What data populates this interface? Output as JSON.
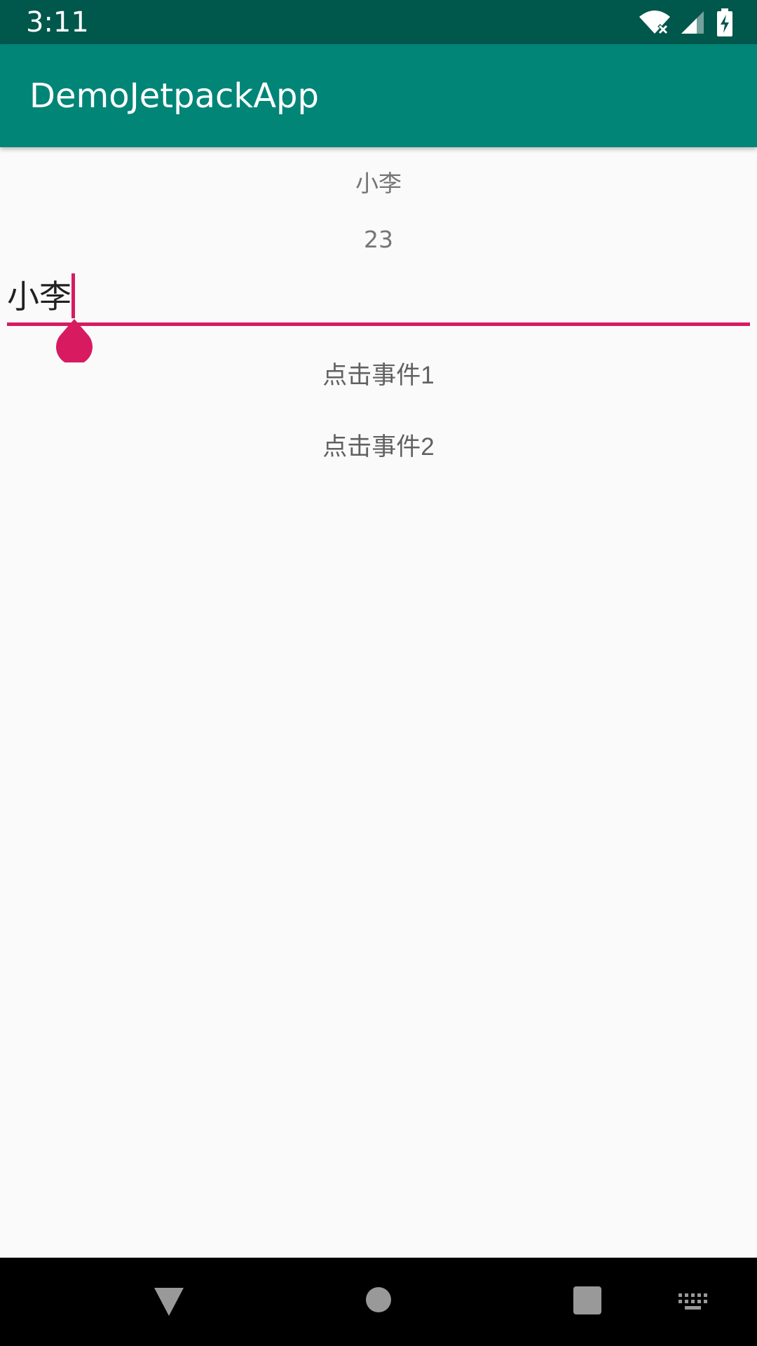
{
  "status_bar": {
    "time": "3:11",
    "icons": [
      "wifi-icon",
      "signal-icon",
      "battery-charging-icon"
    ]
  },
  "app_bar": {
    "title": "DemoJetpackApp"
  },
  "content": {
    "name_text": "小李",
    "age_text": "23",
    "name_input_value": "小李",
    "button_1_label": "点击事件1",
    "button_2_label": "点击事件2"
  },
  "nav_bar": {
    "icons": [
      "back-icon",
      "home-icon",
      "recents-icon",
      "keyboard-icon"
    ]
  },
  "colors": {
    "status_bar": "#00574b",
    "app_bar": "#008577",
    "accent": "#d81b60",
    "background": "#fafafa"
  }
}
